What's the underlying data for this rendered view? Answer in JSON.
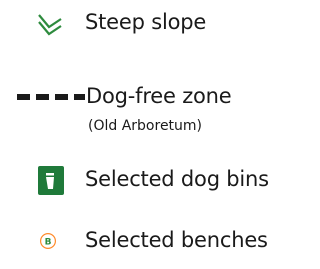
{
  "legend": {
    "items": [
      {
        "icon": "steep-slope-chevron-icon",
        "label": "Steep slope",
        "color": "#2e8b3e"
      },
      {
        "icon": "dashed-line-icon",
        "label": "Dog-free zone",
        "sublabel": "(Old Arboretum)",
        "color": "#1a1a1a"
      },
      {
        "icon": "dog-bin-icon",
        "label": "Selected dog bins",
        "color": "#1f7a3a"
      },
      {
        "icon": "bench-b-icon",
        "label": "Selected benches",
        "color": "#2e8b3e",
        "glyph": "B"
      }
    ]
  }
}
